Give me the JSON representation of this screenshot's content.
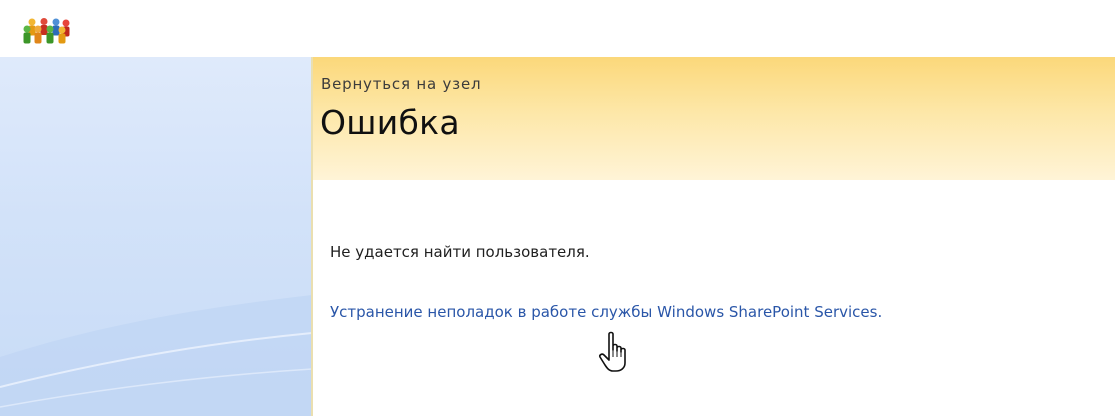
{
  "header": {
    "back_link": "Вернуться на узел",
    "title": "Ошибка"
  },
  "content": {
    "error_message": "Не удается найти пользователя.",
    "help_link": "Устранение неполадок в работе службы Windows SharePoint Services."
  },
  "icons": {
    "logo": "sharepoint-people-logo-icon",
    "cursor": "hand-pointer-cursor-icon"
  },
  "colors": {
    "header_top": "#fbd87a",
    "header_bottom": "#fff4d7",
    "nav_background": "#d2e2f9",
    "link": "#2a56a8"
  }
}
